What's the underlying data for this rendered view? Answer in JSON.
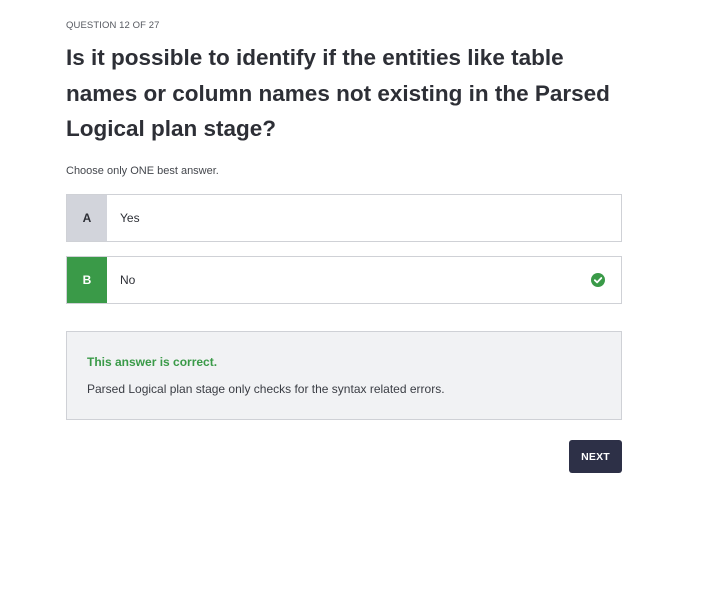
{
  "quiz": {
    "counter": "QUESTION 12 OF 27",
    "question": "Is it possible to identify if the entities like table names or column names not existing in the Parsed Logical plan stage?",
    "instruction": "Choose only ONE best answer.",
    "options": [
      {
        "letter": "A",
        "text": "Yes"
      },
      {
        "letter": "B",
        "text": "No",
        "icon": "check-circle-icon"
      }
    ]
  },
  "feedback": {
    "title": "This answer is correct.",
    "text": "Parsed Logical plan stage only checks for the syntax related errors."
  },
  "actions": {
    "next_label": "NEXT"
  },
  "colors": {
    "correct": "#3a9a48",
    "button": "#2d3047",
    "letter_neutral": "#d2d4db"
  }
}
